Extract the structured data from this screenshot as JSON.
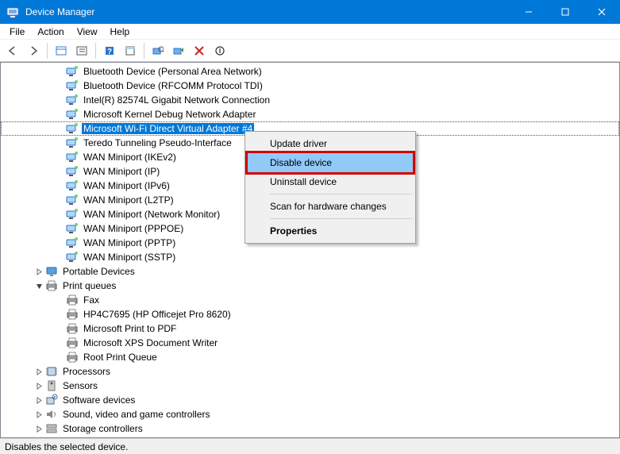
{
  "window": {
    "title": "Device Manager"
  },
  "menubar": [
    "File",
    "Action",
    "View",
    "Help"
  ],
  "toolbar_icons": [
    "back-icon",
    "forward-icon",
    "show-hidden-icon",
    "properties-pane-icon",
    "help-icon",
    "properties-icon",
    "scan-hardware-icon",
    "update-driver-icon",
    "uninstall-icon",
    "disable-icon"
  ],
  "tree": {
    "network_leaves": [
      "Bluetooth Device (Personal Area Network)",
      "Bluetooth Device (RFCOMM Protocol TDI)",
      "Intel(R) 82574L Gigabit Network Connection",
      "Microsoft Kernel Debug Network Adapter",
      "Microsoft Wi-Fi Direct Virtual Adapter #4",
      "Teredo Tunneling Pseudo-Interface",
      "WAN Miniport (IKEv2)",
      "WAN Miniport (IP)",
      "WAN Miniport (IPv6)",
      "WAN Miniport (L2TP)",
      "WAN Miniport (Network Monitor)",
      "WAN Miniport (PPPOE)",
      "WAN Miniport (PPTP)",
      "WAN Miniport (SSTP)"
    ],
    "selected_leaf_index": 4,
    "portable_devices": {
      "label": "Portable Devices",
      "expanded": false
    },
    "print_queues": {
      "label": "Print queues",
      "expanded": true,
      "items": [
        "Fax",
        "HP4C7695 (HP Officejet Pro 8620)",
        "Microsoft Print to PDF",
        "Microsoft XPS Document Writer",
        "Root Print Queue"
      ]
    },
    "categories_tail": [
      "Processors",
      "Sensors",
      "Software devices",
      "Sound, video and game controllers",
      "Storage controllers"
    ]
  },
  "contextmenu": {
    "items": [
      {
        "label": "Update driver",
        "sep_after": false
      },
      {
        "label": "Disable device",
        "highlight": true,
        "callout": true,
        "sep_after": false
      },
      {
        "label": "Uninstall device",
        "sep_after": true
      },
      {
        "label": "Scan for hardware changes",
        "sep_after": true
      },
      {
        "label": "Properties",
        "bold": true
      }
    ]
  },
  "statusbar": "Disables the selected device."
}
